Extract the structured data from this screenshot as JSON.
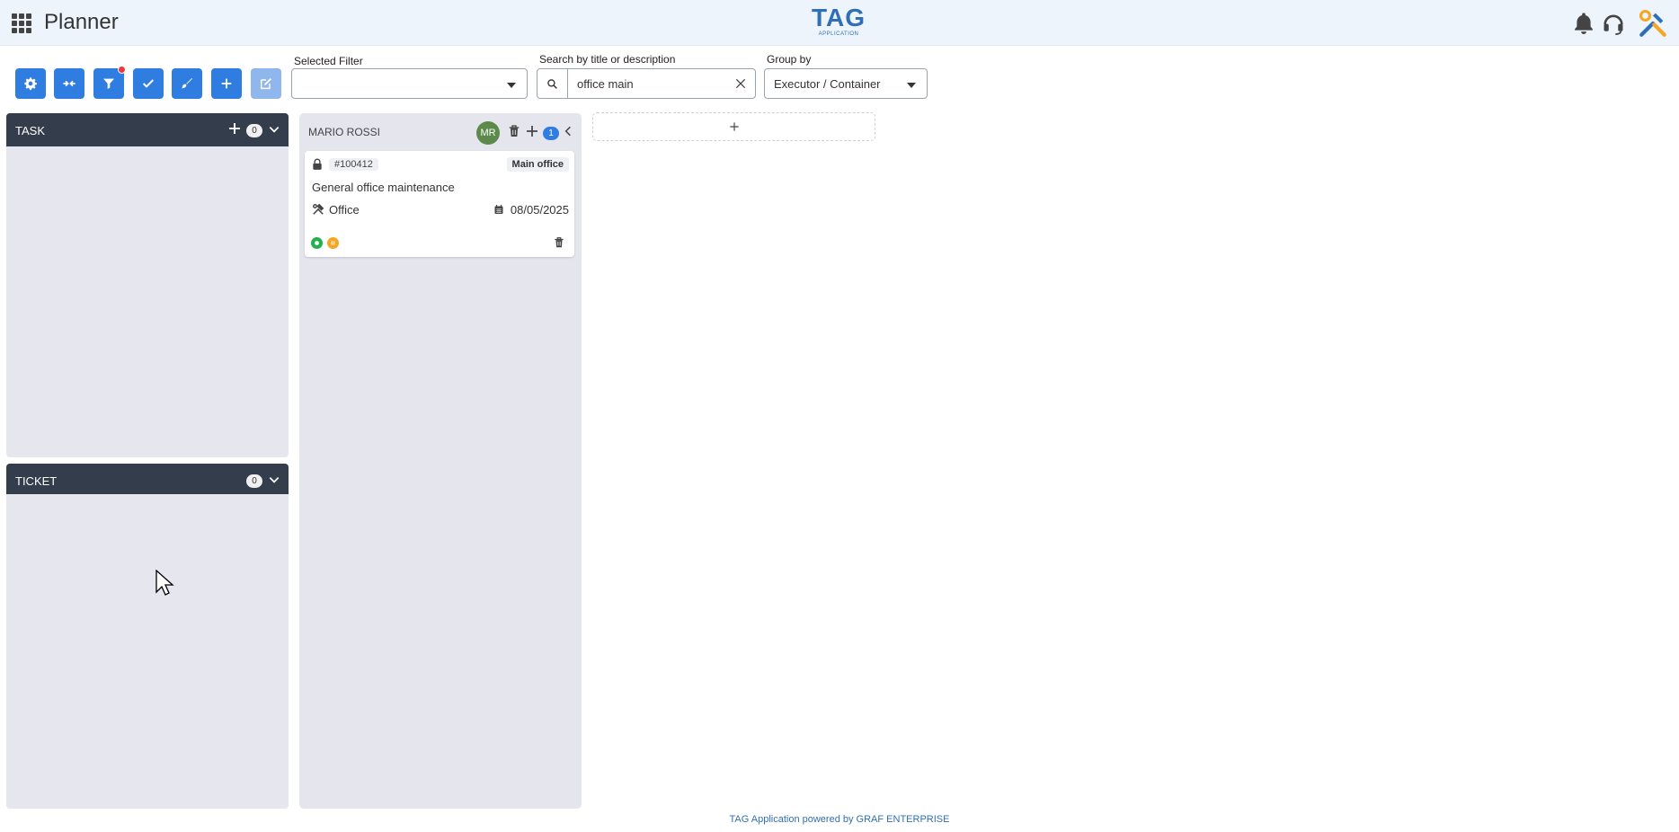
{
  "header": {
    "app_title": "Planner",
    "logo_text": "TAG",
    "logo_sub": "APPLICATION",
    "icons": [
      "apps-grid-icon",
      "bell-icon",
      "headset-icon",
      "tools-icon"
    ]
  },
  "toolbar": {
    "buttons": [
      "gear-icon",
      "collapse-arrows-icon",
      "filter-icon",
      "check-icon",
      "brush-icon",
      "plus-icon",
      "edit-icon"
    ],
    "selected_filter_label": "Selected Filter",
    "selected_filter_value": "",
    "search_label": "Search by title or description",
    "search_value": "office main",
    "group_by_label": "Group by",
    "group_by_value": "Executor / Container"
  },
  "task_panel": {
    "title": "TASK",
    "count": "0"
  },
  "ticket_panel": {
    "title": "TICKET",
    "count": "0"
  },
  "lane": {
    "title": "MARIO ROSSI",
    "avatar_initials": "MR",
    "count": "1",
    "cards": [
      {
        "id": "#100412",
        "location": "Main office",
        "title": "General office maintenance",
        "category": "Office",
        "date": "08/05/2025"
      }
    ]
  },
  "colors": {
    "primary": "#2f7de1",
    "panel_header": "#343d4b",
    "status_green": "#22b14c",
    "status_orange": "#f5a623",
    "filter_badge": "#e83a3a"
  },
  "footer": {
    "text": "TAG Application powered by GRAF ENTERPRISE"
  }
}
